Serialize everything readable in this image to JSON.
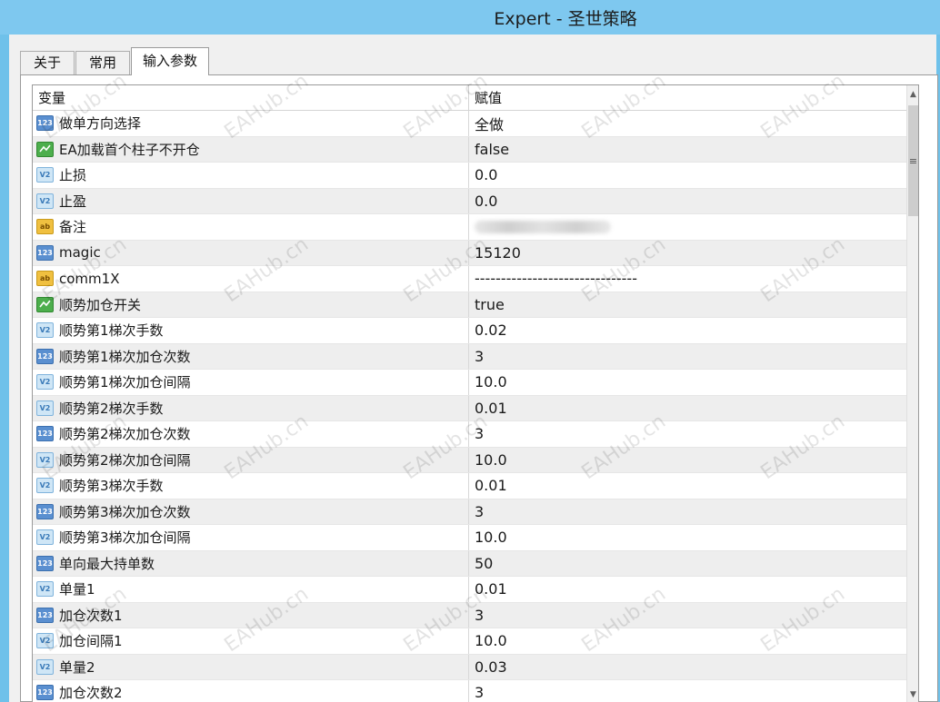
{
  "window": {
    "title": "Expert - 圣世策略"
  },
  "tabs": [
    {
      "label": "关于",
      "active": false
    },
    {
      "label": "常用",
      "active": false
    },
    {
      "label": "输入参数",
      "active": true
    }
  ],
  "grid": {
    "headers": {
      "variable": "变量",
      "value": "赋值"
    },
    "rows": [
      {
        "type": "int",
        "type_icon_text": "123",
        "name": "做单方向选择",
        "value": "全做"
      },
      {
        "type": "bool",
        "type_icon_text": "",
        "name": "EA加载首个柱子不开仓",
        "value": "false"
      },
      {
        "type": "double",
        "type_icon_text": "V2",
        "name": "止损",
        "value": "0.0"
      },
      {
        "type": "double",
        "type_icon_text": "V2",
        "name": "止盈",
        "value": "0.0"
      },
      {
        "type": "string",
        "type_icon_text": "ab",
        "name": "备注",
        "value": ""
      },
      {
        "type": "int",
        "type_icon_text": "123",
        "name": "magic",
        "value": "15120"
      },
      {
        "type": "string",
        "type_icon_text": "ab",
        "name": "comm1X",
        "value": "-------------------------------"
      },
      {
        "type": "bool",
        "type_icon_text": "",
        "name": "顺势加仓开关",
        "value": "true"
      },
      {
        "type": "double",
        "type_icon_text": "V2",
        "name": "顺势第1梯次手数",
        "value": "0.02"
      },
      {
        "type": "int",
        "type_icon_text": "123",
        "name": "顺势第1梯次加仓次数",
        "value": "3"
      },
      {
        "type": "double",
        "type_icon_text": "V2",
        "name": "顺势第1梯次加仓间隔",
        "value": "10.0"
      },
      {
        "type": "double",
        "type_icon_text": "V2",
        "name": "顺势第2梯次手数",
        "value": "0.01"
      },
      {
        "type": "int",
        "type_icon_text": "123",
        "name": "顺势第2梯次加仓次数",
        "value": "3"
      },
      {
        "type": "double",
        "type_icon_text": "V2",
        "name": "顺势第2梯次加仓间隔",
        "value": "10.0"
      },
      {
        "type": "double",
        "type_icon_text": "V2",
        "name": "顺势第3梯次手数",
        "value": "0.01"
      },
      {
        "type": "int",
        "type_icon_text": "123",
        "name": "顺势第3梯次加仓次数",
        "value": "3"
      },
      {
        "type": "double",
        "type_icon_text": "V2",
        "name": "顺势第3梯次加仓间隔",
        "value": "10.0"
      },
      {
        "type": "int",
        "type_icon_text": "123",
        "name": "单向最大持单数",
        "value": "50"
      },
      {
        "type": "double",
        "type_icon_text": "V2",
        "name": "单量1",
        "value": "0.01"
      },
      {
        "type": "int",
        "type_icon_text": "123",
        "name": "加仓次数1",
        "value": "3"
      },
      {
        "type": "double",
        "type_icon_text": "V2",
        "name": "加仓间隔1",
        "value": "10.0"
      },
      {
        "type": "double",
        "type_icon_text": "V2",
        "name": "单量2",
        "value": "0.03"
      },
      {
        "type": "int",
        "type_icon_text": "123",
        "name": "加仓次数2",
        "value": "3"
      }
    ]
  },
  "scrollbar": {
    "up_glyph": "▲",
    "down_glyph": "▼",
    "thumb_glyph": "≡"
  },
  "watermark": {
    "text": "EAHub.cn"
  }
}
